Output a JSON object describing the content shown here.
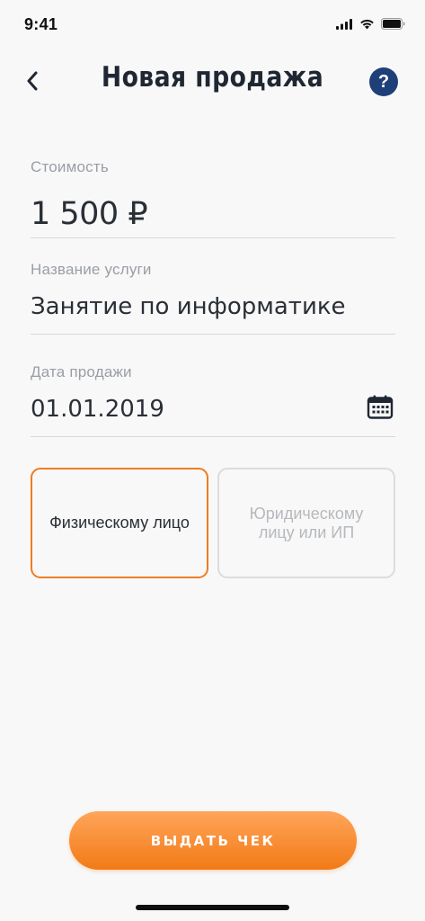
{
  "status_bar": {
    "time": "9:41"
  },
  "header": {
    "title": "Новая продажа",
    "help_label": "?"
  },
  "form": {
    "cost": {
      "label": "Стоимость",
      "value": "1 500 ₽"
    },
    "service": {
      "label": "Название услуги",
      "value": "Занятие по информатике"
    },
    "date": {
      "label": "Дата продажи",
      "value": "01.01.2019"
    }
  },
  "buyer_type": {
    "options": [
      {
        "label": "Физическому лицо",
        "selected": true
      },
      {
        "label": "Юридическому лицу или ИП",
        "selected": false
      }
    ]
  },
  "actions": {
    "issue_label": "ВЫДАТЬ ЧЕК"
  },
  "colors": {
    "accent": "#ee7d22",
    "help": "#1e3f78",
    "text": "#1f2733",
    "muted": "#9a9ea4",
    "border_inactive": "#dcdcdc"
  }
}
